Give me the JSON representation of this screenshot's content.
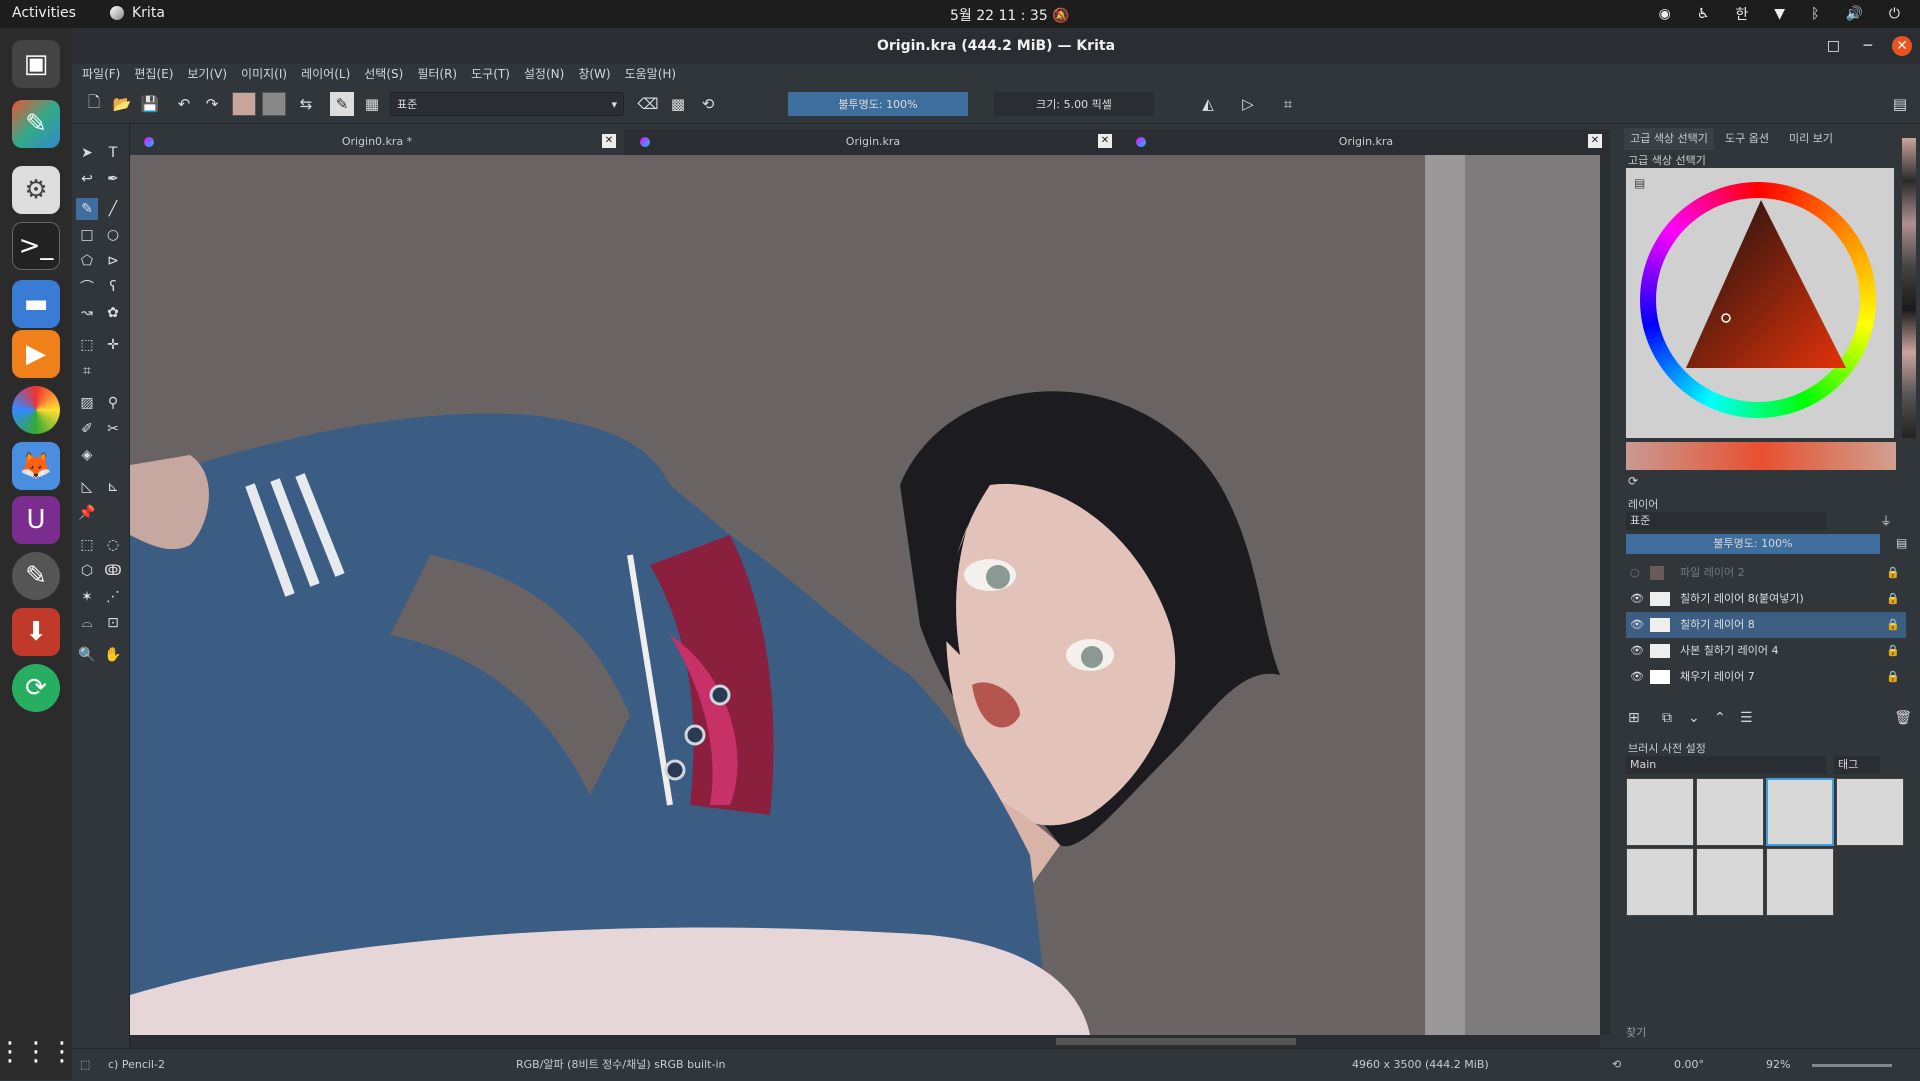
{
  "system": {
    "activities": "Activities",
    "app": "Krita",
    "clock": "5월 22  11 : 35",
    "ime": "한"
  },
  "window": {
    "title": "Origin.kra (444.2 MiB) — Krita"
  },
  "menu": [
    "파일(F)",
    "편집(E)",
    "보기(V)",
    "이미지(I)",
    "레이어(L)",
    "선택(S)",
    "필터(R)",
    "도구(T)",
    "설정(N)",
    "창(W)",
    "도움말(H)"
  ],
  "toolbar": {
    "blend_mode": "표준",
    "opacity": "불투명도: 100%",
    "size": "크기: 5.00 픽셀"
  },
  "tabs": [
    "Origin0.kra *",
    "Origin.kra",
    "Origin.kra"
  ],
  "dockers": {
    "tabs": [
      "고급 색상 선택기",
      "도구 옵션",
      "미리 보기"
    ],
    "color_title": "고급 색상 선택기",
    "layers_title": "레이어",
    "layers_blend": "표준",
    "layers_opacity": "불투명도: 100%",
    "layers": [
      {
        "name": "파일 레이어 2"
      },
      {
        "name": "칠하기 레이어 8(붙여넣기)"
      },
      {
        "name": "칠하기 레이어 8"
      },
      {
        "name": "사본 칠하기 레이어 4"
      },
      {
        "name": "채우기 레이어 7"
      }
    ],
    "brush_title": "브러시 사전 설정",
    "brush_group": "Main",
    "brush_tag": "태그",
    "search": "찾기"
  },
  "status": {
    "brush": "c) Pencil-2",
    "colorspace": "RGB/알파 (8비트 정수/채널)  sRGB built-in",
    "dims": "4960 x 3500 (444.2 MiB)",
    "rotation": "0.00°",
    "zoom": "92%"
  },
  "colors": {
    "accent": "#3d6e9e",
    "selected_layer": "#3b5e82",
    "close_button": "#e95420"
  }
}
